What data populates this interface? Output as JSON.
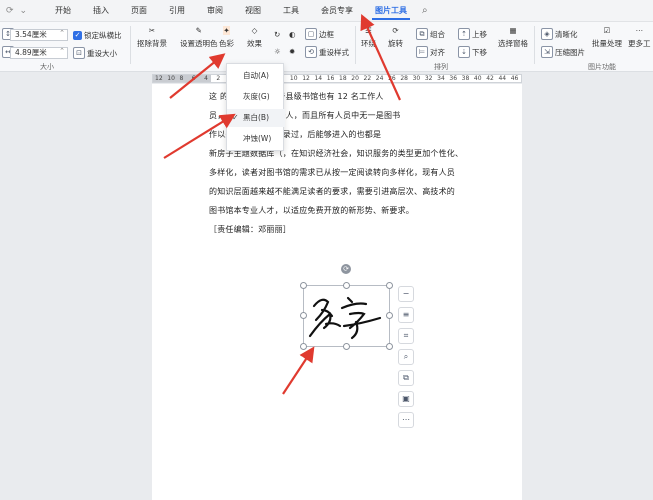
{
  "menubar": {
    "quick_icons": [
      "refresh-icon",
      "chevron-down-icon"
    ],
    "tabs": [
      "开始",
      "插入",
      "页面",
      "引用",
      "审阅",
      "视图",
      "工具",
      "会员专享",
      "图片工具"
    ],
    "active_tab": "图片工具"
  },
  "ribbon": {
    "height_value": "3.54厘米",
    "width_value": "4.89厘米",
    "lock_ratio_label": "锁定纵横比",
    "reset_size_label": "重设大小",
    "size_group_label": "大小",
    "remove_bg_label": "抠除背景",
    "set_transparent_label": "设置透明色",
    "color_label": "色彩",
    "effects_label": "效果",
    "border_label": "边框",
    "reset_style_label": "重设样式",
    "wrap_label": "环绕",
    "rotate_label": "旋转",
    "group_label": "组合",
    "align_label": "对齐",
    "bring_forward_label": "上移",
    "send_backward_label": "下移",
    "selection_pane_label": "选择窗格",
    "arrange_group_label": "排列",
    "sharpen_label": "清晰化",
    "compress_label": "压缩图片",
    "batch_label": "批量处理",
    "more_tools_label": "更多工",
    "image_features_label": "图片功能"
  },
  "ruler": {
    "ticks": [
      "12",
      "10",
      "8",
      "6",
      "4",
      "2",
      "",
      "2",
      "4",
      "6",
      "8",
      "10",
      "12",
      "14",
      "16",
      "18",
      "20",
      "22",
      "24",
      "26",
      "28",
      "30",
      "32",
      "34",
      "36",
      "38",
      "40",
      "42",
      "44",
      "46"
    ]
  },
  "document": {
    "lines": [
      "这                            的共性问题，我于县级书馆也有 12 名工作人",
      "员，                  毕业人员只有一人，而且所有人员中无一是图书",
      "                         作以来，没有公开招录过，后能够进入的也都是",
      "新房子主题数据库（，在知识经济社会，知识服务的类型更加个性化、",
      "多样化，读者对图书馆的需求已从按一定阅读转向多样化，现有人员",
      "的知识层面越来越不能满足读者的要求，需要引进高层次、高技术的",
      "图书馆本专业人才，以适应免费开放的新形势、新要求。",
      "［责任编辑：邓丽丽］"
    ],
    "signature_text": "名字"
  },
  "color_dropdown": {
    "options": [
      "自动(A)",
      "灰度(G)",
      "黑白(B)",
      "冲蚀(W)"
    ],
    "checked": "黑白(B)"
  },
  "floating_tools": [
    "minus-icon",
    "layout-icon",
    "crop-icon",
    "zoom-icon",
    "copy-icon",
    "image-icon",
    "more-icon"
  ],
  "colors": {
    "accent": "#2f6fe5",
    "arrow": "#e03a2f"
  }
}
